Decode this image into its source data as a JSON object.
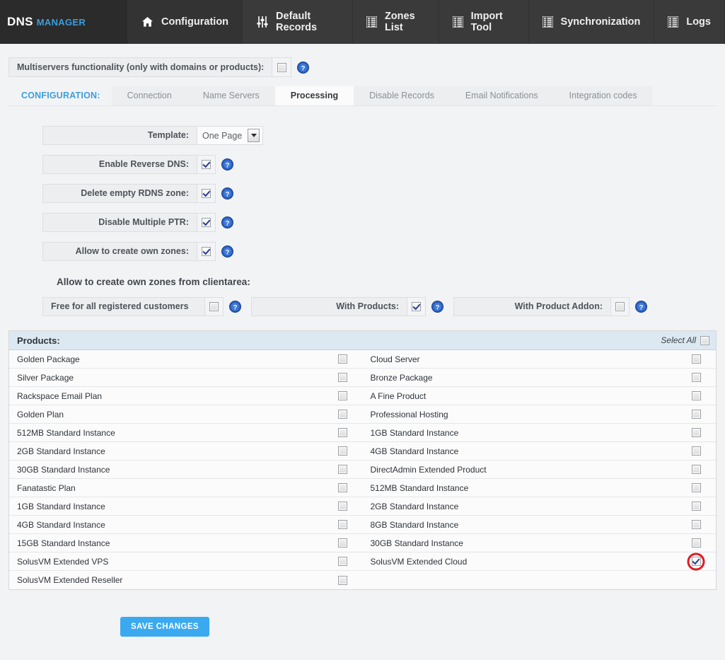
{
  "brand": {
    "primary": "DNS",
    "secondary": "MANAGER"
  },
  "nav": {
    "items": [
      {
        "label": "Configuration",
        "icon": "home-icon",
        "active": true
      },
      {
        "label": "Default Records",
        "icon": "sliders-icon",
        "active": false
      },
      {
        "label": "Zones List",
        "icon": "list-icon",
        "active": false
      },
      {
        "label": "Import Tool",
        "icon": "list-icon",
        "active": false
      },
      {
        "label": "Synchronization",
        "icon": "list-icon",
        "active": false
      },
      {
        "label": "Logs",
        "icon": "list-icon",
        "active": false
      }
    ]
  },
  "multiservers": {
    "label": "Multiservers functionality (only with domains or products):",
    "checked": false
  },
  "tabs": {
    "section_label": "CONFIGURATION:",
    "items": [
      {
        "label": "Connection",
        "active": false
      },
      {
        "label": "Name Servers",
        "active": false
      },
      {
        "label": "Processing",
        "active": true
      },
      {
        "label": "Disable Records",
        "active": false
      },
      {
        "label": "Email Notifications",
        "active": false
      },
      {
        "label": "Integration codes",
        "active": false
      }
    ]
  },
  "form": {
    "template": {
      "label": "Template:",
      "value": "One Page"
    },
    "toggles": [
      {
        "label": "Enable Reverse DNS:",
        "checked": true
      },
      {
        "label": "Delete empty RDNS zone:",
        "checked": true
      },
      {
        "label": "Disable Multiple PTR:",
        "checked": true
      },
      {
        "label": "Allow to create own zones:",
        "checked": true
      }
    ]
  },
  "clientarea": {
    "heading": "Allow to create own zones from clientarea:",
    "options": [
      {
        "label": "Free for all registered customers",
        "checked": false
      },
      {
        "label": "With Products:",
        "checked": true
      },
      {
        "label": "With Product Addon:",
        "checked": false
      }
    ]
  },
  "products": {
    "title": "Products:",
    "select_all_label": "Select All",
    "select_all_checked": false,
    "rows": [
      {
        "left": {
          "name": "Golden Package",
          "checked": false
        },
        "right": {
          "name": "Cloud Server",
          "checked": false
        }
      },
      {
        "left": {
          "name": "Silver Package",
          "checked": false
        },
        "right": {
          "name": "Bronze Package",
          "checked": false
        }
      },
      {
        "left": {
          "name": "Rackspace Email Plan",
          "checked": false
        },
        "right": {
          "name": "A Fine Product",
          "checked": false
        }
      },
      {
        "left": {
          "name": "Golden Plan",
          "checked": false
        },
        "right": {
          "name": "Professional Hosting",
          "checked": false
        }
      },
      {
        "left": {
          "name": "512MB Standard Instance",
          "checked": false
        },
        "right": {
          "name": "1GB Standard Instance",
          "checked": false
        }
      },
      {
        "left": {
          "name": "2GB Standard Instance",
          "checked": false
        },
        "right": {
          "name": "4GB Standard Instance",
          "checked": false
        }
      },
      {
        "left": {
          "name": "30GB Standard Instance",
          "checked": false
        },
        "right": {
          "name": "DirectAdmin Extended Product",
          "checked": false
        }
      },
      {
        "left": {
          "name": "Fanatastic Plan",
          "checked": false
        },
        "right": {
          "name": "512MB Standard Instance",
          "checked": false
        }
      },
      {
        "left": {
          "name": "1GB Standard Instance",
          "checked": false
        },
        "right": {
          "name": "2GB Standard Instance",
          "checked": false
        }
      },
      {
        "left": {
          "name": "4GB Standard Instance",
          "checked": false
        },
        "right": {
          "name": "8GB Standard Instance",
          "checked": false
        }
      },
      {
        "left": {
          "name": "15GB Standard Instance",
          "checked": false
        },
        "right": {
          "name": "30GB Standard Instance",
          "checked": false
        }
      },
      {
        "left": {
          "name": "SolusVM Extended VPS",
          "checked": false
        },
        "right": {
          "name": "SolusVM Extended Cloud",
          "checked": true,
          "annotated": true
        }
      },
      {
        "left": {
          "name": "SolusVM Extended Reseller",
          "checked": false
        },
        "right": null
      }
    ]
  },
  "save": {
    "label": "SAVE CHANGES"
  },
  "colors": {
    "brand_accent": "#3a9ede",
    "nav_bg": "#3a3a3a",
    "brand_bg": "#2b2b2b",
    "page_bg": "#f2f3f5",
    "table_head_bg": "#dce9f2",
    "save_btn": "#3ba9f0",
    "annotation": "#e01b22",
    "help_icon": "#2a5fc0"
  }
}
